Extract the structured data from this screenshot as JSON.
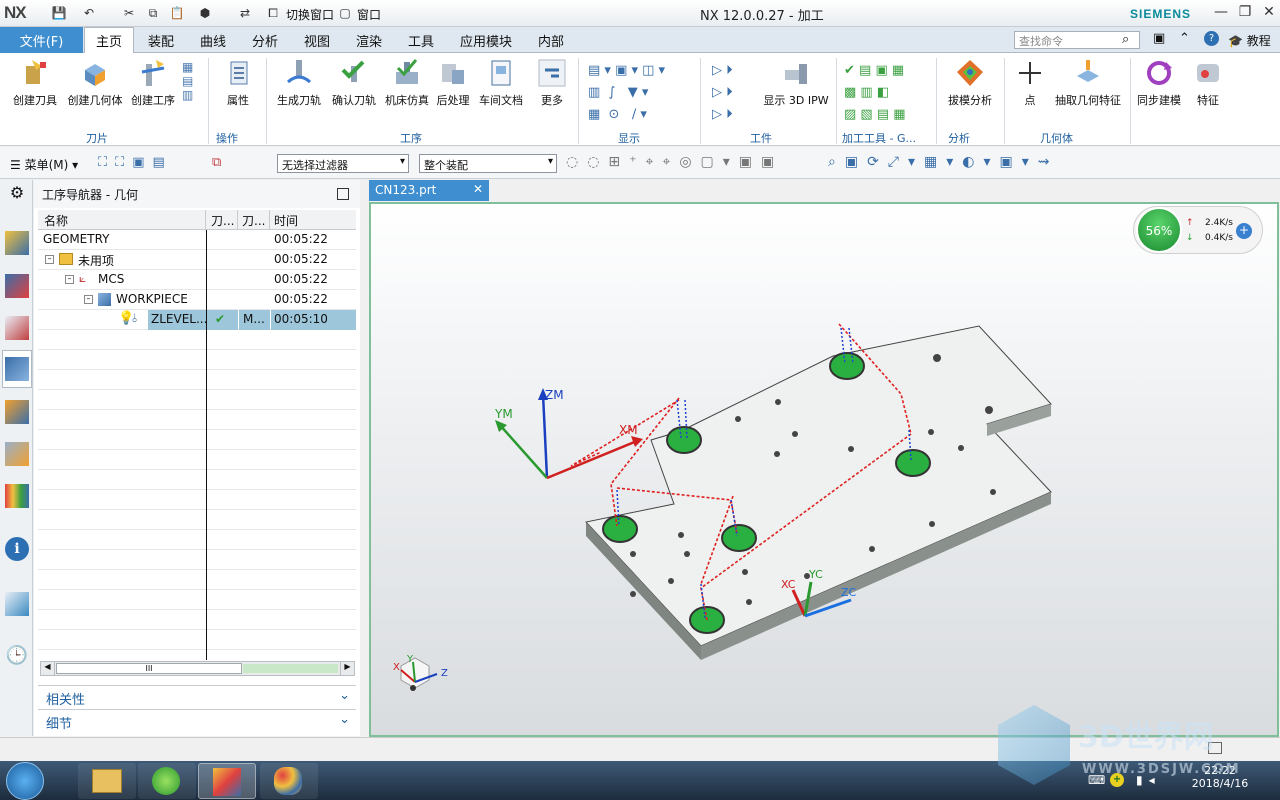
{
  "app": {
    "logo": "NX",
    "title": "NX 12.0.0.27 - 加工",
    "vendor": "SIEMENS"
  },
  "quick_access": {
    "switch_window": "切换窗口",
    "window": "窗口"
  },
  "tabs": [
    {
      "label": "文件(F)"
    },
    {
      "label": "主页"
    },
    {
      "label": "装配"
    },
    {
      "label": "曲线"
    },
    {
      "label": "分析"
    },
    {
      "label": "视图"
    },
    {
      "label": "渲染"
    },
    {
      "label": "工具"
    },
    {
      "label": "应用模块"
    },
    {
      "label": "内部"
    }
  ],
  "command_search": {
    "placeholder": "查找命令"
  },
  "tutorial": "教程",
  "ribbon": {
    "buttons": [
      {
        "label": "创建刀具",
        "icon": "create-tool-icon"
      },
      {
        "label": "创建几何体",
        "icon": "create-geometry-icon"
      },
      {
        "label": "创建工序",
        "icon": "create-operation-icon"
      },
      {
        "label": "属性",
        "icon": "properties-icon"
      },
      {
        "label": "生成刀轨",
        "icon": "generate-toolpath-icon"
      },
      {
        "label": "确认刀轨",
        "icon": "verify-toolpath-icon"
      },
      {
        "label": "机床仿真",
        "icon": "machine-simulation-icon"
      },
      {
        "label": "后处理",
        "icon": "postprocess-icon"
      },
      {
        "label": "车间文档",
        "icon": "shop-doc-icon"
      },
      {
        "label": "更多",
        "icon": "more-icon"
      },
      {
        "label": "显示 3D IPW",
        "icon": "ipw-icon"
      },
      {
        "label": "拔模分析",
        "icon": "draft-analysis-icon"
      },
      {
        "label": "点",
        "icon": "point-icon"
      },
      {
        "label": "抽取几何特征",
        "icon": "extract-geometry-icon"
      },
      {
        "label": "同步建模",
        "icon": "sync-modeling-icon"
      },
      {
        "label": "特征",
        "icon": "feature-icon"
      }
    ],
    "groups": [
      "刀片",
      "操作",
      "工序",
      "显示",
      "工件",
      "加工工具 - G...",
      "分析",
      "几何体"
    ]
  },
  "toolbar2": {
    "menu": "菜单(M)",
    "filter": "无选择过滤器",
    "scope": "整个装配"
  },
  "navigator": {
    "title": "工序导航器 - 几何",
    "columns": [
      "名称",
      "刀...",
      "刀...",
      "时间"
    ],
    "rows": [
      {
        "name": "GEOMETRY",
        "c2": "",
        "c3": "",
        "time": "00:05:22"
      },
      {
        "name": "未用项",
        "c2": "",
        "c3": "",
        "time": "00:05:22"
      },
      {
        "name": "MCS",
        "c2": "",
        "c3": "",
        "time": "00:05:22"
      },
      {
        "name": "WORKPIECE",
        "c2": "",
        "c3": "",
        "time": "00:05:22"
      },
      {
        "name": "ZLEVEL...",
        "c2": "✔",
        "c3": "M...",
        "time": "00:05:10"
      }
    ],
    "scroll_mark": "III",
    "accordion": [
      "相关性",
      "细节"
    ]
  },
  "viewport": {
    "tab": "CN123.prt",
    "progress": 56,
    "progress_label": "56%",
    "up_rate": "2.4K/s",
    "down_rate": "0.4K/s",
    "axes": {
      "zm": "ZM",
      "ym": "YM",
      "xm": "XM",
      "xc": "XC",
      "yc": "YC",
      "zc": "ZC",
      "tx": "X",
      "ty": "Y",
      "tz": "Z"
    }
  },
  "watermark": {
    "brand": "3D世界网",
    "url": "WWW.3DSJW.COM"
  },
  "taskbar": {
    "time": "22:22",
    "date": "2018/4/16"
  },
  "colors": {
    "accent": "#3f8fd0",
    "selection": "#9dc6db",
    "viewport_border": "#7fbf9a"
  }
}
